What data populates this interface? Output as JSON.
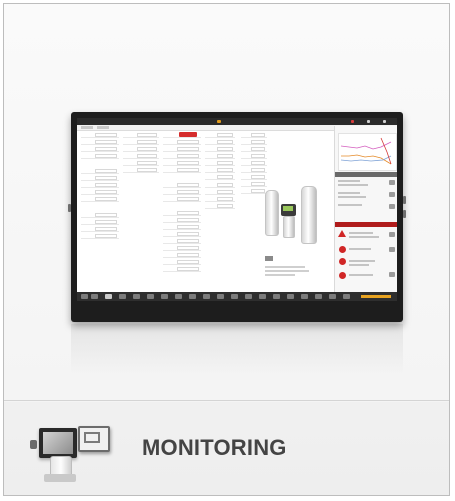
{
  "card": {
    "title": "MONITORING",
    "icon": "monitoring-icon"
  },
  "screenshot": {
    "app_brand": "",
    "app_title": "",
    "accent_color": "#e09a1a",
    "alert_color": "#d02626"
  },
  "colors": {
    "title_text": "#444444",
    "card_border": "#bdbdbd",
    "background": "#f4f4f4"
  }
}
